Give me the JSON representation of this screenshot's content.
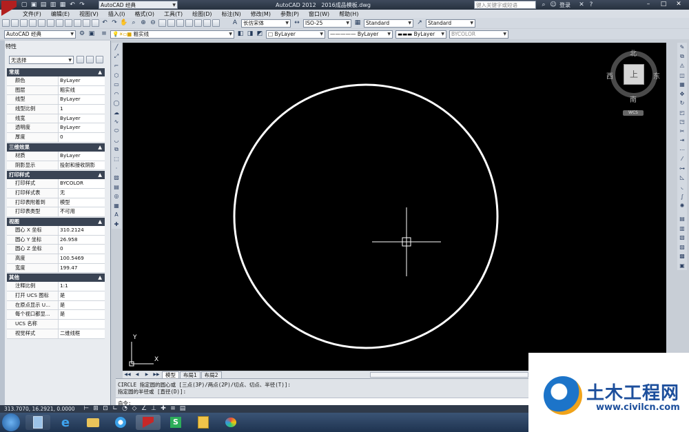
{
  "window": {
    "title_app": "AutoCAD 2012",
    "title_file": "2016成品模板.dwg",
    "workspace": "AutoCAD 经典",
    "search_placeholder": "键入关键字或短语",
    "login": "登录"
  },
  "menu": [
    "文件(F)",
    "编辑(E)",
    "视图(V)",
    "插入(I)",
    "格式(O)",
    "工具(T)",
    "绘图(D)",
    "标注(N)",
    "修改(M)",
    "参数(P)",
    "窗口(W)",
    "帮助(H)"
  ],
  "toolbar": {
    "text_style": "长仿宋体",
    "dim_style": "ISO-25",
    "table_style": "Standard",
    "mleader_style": "Standard",
    "workspace2": "AutoCAD 经典",
    "layer": "粗实线",
    "color": "ByLayer",
    "linetype": "ByLayer",
    "lineweight": "ByLayer",
    "plotstyle": "BYCOLOR"
  },
  "properties": {
    "title": "特性",
    "selection": "无选择",
    "sections": [
      {
        "name": "常规",
        "rows": [
          {
            "k": "颜色",
            "v": "ByLayer"
          },
          {
            "k": "图层",
            "v": "粗实线"
          },
          {
            "k": "线型",
            "v": "ByLayer"
          },
          {
            "k": "线型比例",
            "v": "1"
          },
          {
            "k": "线宽",
            "v": "ByLayer"
          },
          {
            "k": "透明度",
            "v": "ByLayer"
          },
          {
            "k": "厚度",
            "v": "0"
          }
        ]
      },
      {
        "name": "三维效果",
        "rows": [
          {
            "k": "材质",
            "v": "ByLayer"
          },
          {
            "k": "阴影显示",
            "v": "投射和接收阴影"
          }
        ]
      },
      {
        "name": "打印样式",
        "rows": [
          {
            "k": "打印样式",
            "v": "BYCOLOR"
          },
          {
            "k": "打印样式表",
            "v": "无"
          },
          {
            "k": "打印表附着到",
            "v": "模型"
          },
          {
            "k": "打印表类型",
            "v": "不可用"
          }
        ]
      },
      {
        "name": "视图",
        "rows": [
          {
            "k": "圆心 X 坐标",
            "v": "310.2124"
          },
          {
            "k": "圆心 Y 坐标",
            "v": "26.958"
          },
          {
            "k": "圆心 Z 坐标",
            "v": "0"
          },
          {
            "k": "高度",
            "v": "100.5469"
          },
          {
            "k": "宽度",
            "v": "199.47"
          }
        ]
      },
      {
        "name": "其他",
        "rows": [
          {
            "k": "注释比例",
            "v": "1:1"
          },
          {
            "k": "打开 UCS 图标",
            "v": "是"
          },
          {
            "k": "在原点显示 U...",
            "v": "是"
          },
          {
            "k": "每个视口都显...",
            "v": "是"
          },
          {
            "k": "UCS 名称",
            "v": ""
          },
          {
            "k": "视觉样式",
            "v": "二维线框"
          }
        ]
      }
    ]
  },
  "viewcube": {
    "north": "北",
    "south": "南",
    "east": "东",
    "west": "西",
    "top": "上",
    "ucs": "WCS"
  },
  "ucs_icon": {
    "x": "X",
    "y": "Y"
  },
  "tabs": [
    "模型",
    "布局1",
    "布局2"
  ],
  "command": {
    "line1": "CIRCLE 指定圆的圆心或 [三点(3P)/两点(2P)/切点、切点、半径(T)]:",
    "line2": "指定圆的半径或 [直径(D)]:",
    "prompt": "命令:"
  },
  "status": {
    "coords": "313.7070, 16.2921, 0.0000"
  },
  "watermark": {
    "brand": "土木工程网",
    "url": "www.civilcn.com"
  },
  "colors": {
    "canvas": "#000000",
    "panel_header": "#3a4454",
    "title_bar": "#2f3a4a",
    "taskbar": "#2a3f5c"
  }
}
